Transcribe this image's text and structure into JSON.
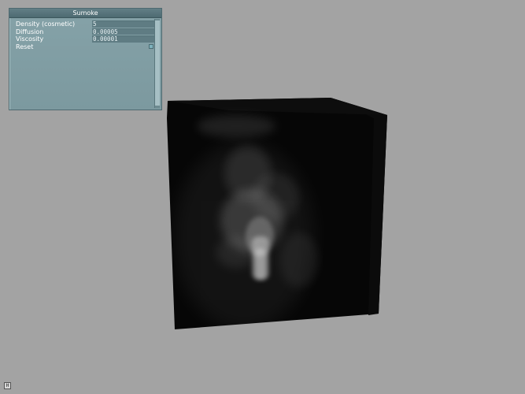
{
  "panel": {
    "title": "Sumoke",
    "params": [
      {
        "label": "Density (cosmetic)",
        "value": "5"
      },
      {
        "label": "Diffusion",
        "value": "0.00005"
      },
      {
        "label": "Viscosity",
        "value": "0.00001"
      }
    ],
    "reset_label": "Reset"
  },
  "viewport": {
    "background_color": "#a3a3a3",
    "cube_color": "#060606",
    "smoke_color": "#ffffff"
  },
  "corner_icon": {
    "name": "window-icon",
    "glyph": "H"
  }
}
